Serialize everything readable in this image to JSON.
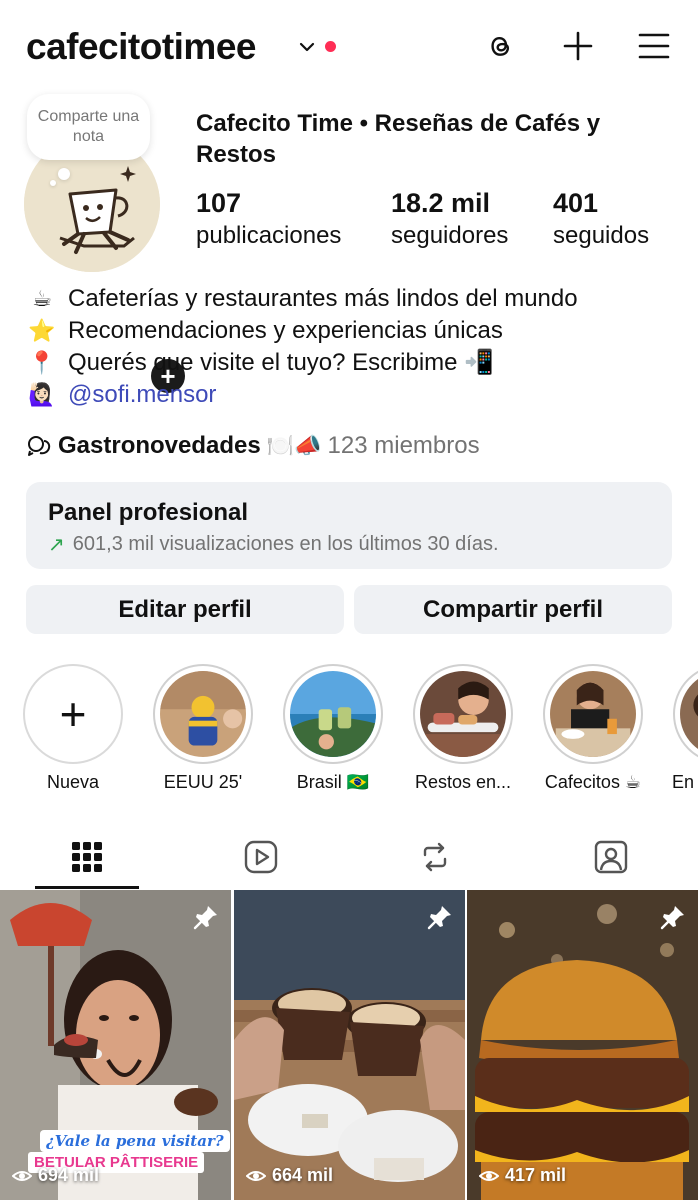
{
  "header": {
    "username": "cafecitotimee",
    "colors": {
      "notification_dot": "#ff2d55"
    }
  },
  "profile": {
    "note": "Comparte una nota",
    "display_name": "Cafecito Time • Reseñas de Cafés y Restos",
    "stats": [
      {
        "value": "107",
        "label": "publicaciones"
      },
      {
        "value": "18.2 mil",
        "label": "seguidores"
      },
      {
        "value": "401",
        "label": "seguidos"
      }
    ],
    "bio": [
      {
        "emoji": "☕",
        "text": "Cafeterías y restaurantes más lindos del mundo"
      },
      {
        "emoji": "⭐",
        "text": "Recomendaciones y experiencias únicas"
      },
      {
        "emoji": "📍",
        "text": "Querés que visite el tuyo? Escribime 📲"
      },
      {
        "emoji": "🙋🏻‍♀️",
        "text": "@sofi.mensor"
      }
    ],
    "channel": {
      "name": "Gastronovedades",
      "emoji": "🍽️📣",
      "members": "123 miembros"
    }
  },
  "panel": {
    "title": "Panel profesional",
    "arrow": "↗",
    "subtitle": "601,3 mil visualizaciones en los últimos 30 días."
  },
  "buttons": {
    "edit": "Editar perfil",
    "share": "Compartir perfil"
  },
  "highlights": [
    {
      "label": "Nueva"
    },
    {
      "label": "EEUU 25'"
    },
    {
      "label": "Brasil 🇧🇷"
    },
    {
      "label": "Restos en..."
    },
    {
      "label": "Cafecitos ☕"
    },
    {
      "label": "En"
    }
  ],
  "tabs": [
    "posts-grid-icon",
    "reels-icon",
    "reposts-icon",
    "tagged-icon"
  ],
  "posts": [
    {
      "views": "694 mil",
      "overlay_question": "¿Vale la pena visitar?",
      "overlay_name": "BETULAR PÂTTISERIE"
    },
    {
      "views": "664 mil"
    },
    {
      "views": "417 mil"
    }
  ]
}
